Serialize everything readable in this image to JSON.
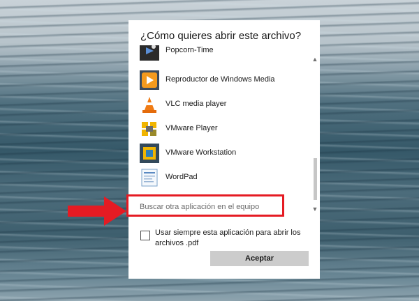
{
  "dialog": {
    "title": "¿Cómo quieres abrir este archivo?",
    "apps": [
      {
        "label": "Popcorn-Time",
        "icon": "popcorn-time-icon"
      },
      {
        "label": "Reproductor de Windows Media",
        "icon": "windows-media-player-icon"
      },
      {
        "label": "VLC media player",
        "icon": "vlc-cone-icon"
      },
      {
        "label": "VMware Player",
        "icon": "vmware-player-icon"
      },
      {
        "label": "VMware Workstation",
        "icon": "vmware-workstation-icon"
      },
      {
        "label": "WordPad",
        "icon": "wordpad-icon"
      }
    ],
    "find_other_app": "Buscar otra aplicación en el equipo",
    "always_use_label": "Usar siempre esta aplicación para abrir los archivos .pdf",
    "accept_label": "Aceptar"
  },
  "colors": {
    "highlight": "#e51b23",
    "button_bg": "#cccccc"
  }
}
